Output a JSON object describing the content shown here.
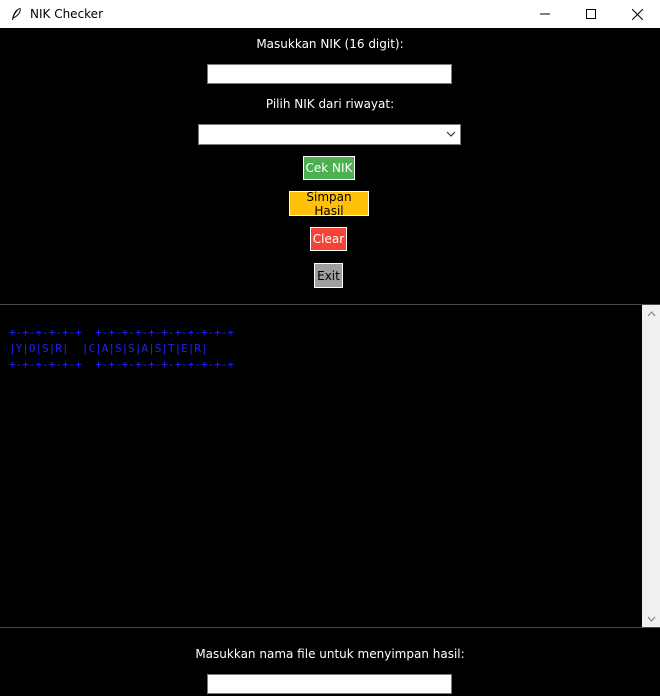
{
  "window": {
    "title": "NIK Checker"
  },
  "form": {
    "nik_label": "Masukkan NIK (16 digit):",
    "nik_value": "",
    "history_label": "Pilih NIK dari riwayat:",
    "history_selected": ""
  },
  "buttons": {
    "check": {
      "label": "Cek NIK",
      "color": "#4caf50"
    },
    "save": {
      "label": "Simpan Hasil",
      "color": "#ffc107"
    },
    "clear": {
      "label": "Clear",
      "color": "#f44336"
    },
    "exit": {
      "label": "Exit",
      "color": "#9e9e9e"
    }
  },
  "output": {
    "banner_top": "+-+-+-+-+-+  +-+-+-+-+-+-+-+-+-+-+",
    "banner_mid": "|Y|O|S|R|  |C|A|S|S|A|S|T|E|R|",
    "banner_bot": "+-+-+-+-+-+  +-+-+-+-+-+-+-+-+-+-+",
    "text_color": "#2020ff"
  },
  "save_section": {
    "filename_label": "Masukkan nama file untuk menyimpan hasil:",
    "filename_value": ""
  }
}
